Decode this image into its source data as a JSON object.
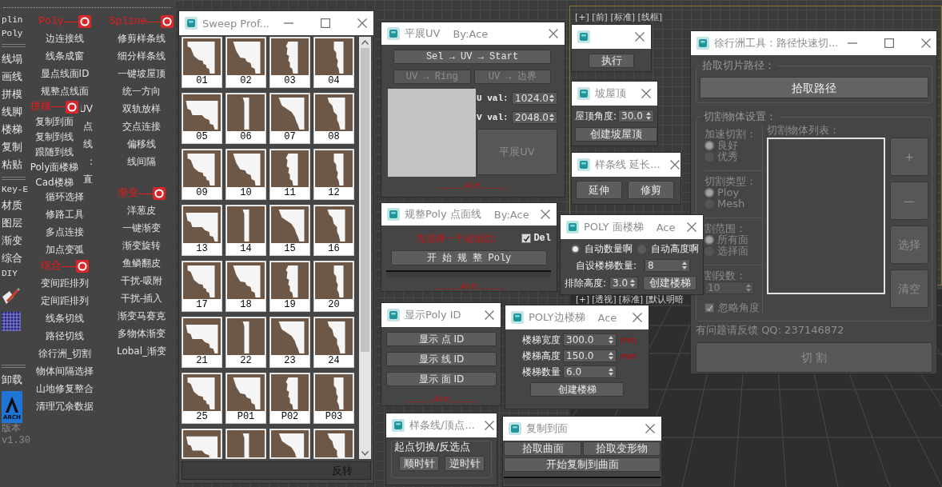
{
  "toolbar": {
    "side": [
      {
        "kind": "latin",
        "label": "plin"
      },
      {
        "kind": "latin",
        "label": "Poly"
      },
      {
        "kind": "divider"
      },
      {
        "kind": "text",
        "label": "线塌"
      },
      {
        "kind": "text",
        "label": "画线"
      },
      {
        "kind": "text",
        "label": "拼模"
      },
      {
        "kind": "text",
        "label": "线脚"
      },
      {
        "kind": "text",
        "label": "楼梯"
      },
      {
        "kind": "text",
        "label": "复制"
      },
      {
        "kind": "text",
        "label": "粘贴"
      },
      {
        "kind": "divider"
      },
      {
        "kind": "latin",
        "label": "Key-E"
      },
      {
        "kind": "text",
        "label": "材质"
      },
      {
        "kind": "text",
        "label": "图层"
      },
      {
        "kind": "text",
        "label": "渐变"
      },
      {
        "kind": "text",
        "label": "综合"
      },
      {
        "kind": "latin",
        "label": "DIY"
      },
      {
        "kind": "brush_icon"
      },
      {
        "kind": "grid_icon"
      },
      {
        "kind": "divider"
      },
      {
        "kind": "text",
        "label": "卸载"
      },
      {
        "kind": "logo",
        "label": "ARCH"
      },
      {
        "kind": "version",
        "label": "版本"
      },
      {
        "kind": "version",
        "label": "v1.30"
      }
    ],
    "columns": [
      {
        "sections": [
          {
            "header": "Poly",
            "items": [
              {
                "label": "边连接线",
                "covered": false
              },
              {
                "label": "线条成窗",
                "covered": false
              },
              {
                "label": "显点线面ID",
                "covered": false
              },
              {
                "label": "规整点线面",
                "covered": false
              },
              {
                "label": "UV",
                "covered": true
              },
              {
                "label": "点",
                "covered": true
              },
              {
                "label": "线",
                "covered": true
              },
              {
                "label": ":",
                "covered": true
              },
              {
                "label": "直",
                "covered": true
              },
              {
                "label": "循环选择",
                "covered": false
              },
              {
                "label": "修路工具",
                "covered": false
              },
              {
                "label": "多点连接",
                "covered": false
              },
              {
                "label": "加点变弧",
                "covered": false
              }
            ]
          },
          {
            "header": "综合",
            "items": [
              {
                "label": "变间距排列"
              },
              {
                "label": "定间距排列"
              },
              {
                "label": "线条切线"
              },
              {
                "label": "路径切线"
              },
              {
                "label": "徐行洲_切割"
              },
              {
                "label": "物体间隔选择"
              },
              {
                "label": "山地修复整合"
              },
              {
                "label": "清理冗余数据"
              }
            ]
          }
        ]
      },
      {
        "sections": [
          {
            "header": "Spline",
            "items": [
              {
                "label": "修剪样条线"
              },
              {
                "label": "细分样条线"
              },
              {
                "label": "一键坡屋顶"
              },
              {
                "label": "统一方向"
              },
              {
                "label": "双轨放样"
              },
              {
                "label": "交点连接"
              },
              {
                "label": "偏移线"
              },
              {
                "label": "线间隔"
              }
            ]
          },
          {
            "header": "渐变",
            "items": [
              {
                "label": "洋葱皮"
              },
              {
                "label": "一键渐变"
              },
              {
                "label": "渐变旋转"
              },
              {
                "label": "鱼鳞翻皮"
              },
              {
                "label": "干扰-吸附"
              },
              {
                "label": "干扰-插入"
              },
              {
                "label": "渐变马赛克"
              },
              {
                "label": "多物体渐变"
              },
              {
                "label": "Lobal_渐变"
              }
            ]
          }
        ]
      }
    ],
    "popup": {
      "header": "拼模",
      "items": [
        "复制到面",
        "复制到线",
        "跟随到线",
        "Poly面楼梯",
        "Cad楼梯"
      ]
    }
  },
  "viewport_labels": [
    "[+] [前] [标准] [线框]",
    "[+] [透视] [标准] [默认明暗"
  ],
  "windows": [
    {
      "kind": "profiles",
      "title": "Sweep Prof...",
      "min_max": true,
      "profiles": [
        {
          "label": "01",
          "cut_off": false
        },
        {
          "label": "02",
          "cut_off": false
        },
        {
          "label": "03",
          "cut_off": false
        },
        {
          "label": "04",
          "cut_off": false
        },
        {
          "label": "05",
          "cut_off": false
        },
        {
          "label": "06",
          "cut_off": false
        },
        {
          "label": "07",
          "cut_off": false
        },
        {
          "label": "08",
          "cut_off": false
        },
        {
          "label": "09",
          "cut_off": false
        },
        {
          "label": "10",
          "cut_off": false
        },
        {
          "label": "11",
          "cut_off": false
        },
        {
          "label": "12",
          "cut_off": false
        },
        {
          "label": "13",
          "cut_off": false
        },
        {
          "label": "14",
          "cut_off": false
        },
        {
          "label": "15",
          "cut_off": false
        },
        {
          "label": "16",
          "cut_off": false
        },
        {
          "label": "17",
          "cut_off": false
        },
        {
          "label": "18",
          "cut_off": false
        },
        {
          "label": "19",
          "cut_off": false
        },
        {
          "label": "20",
          "cut_off": false
        },
        {
          "label": "21",
          "cut_off": false
        },
        {
          "label": "22",
          "cut_off": false
        },
        {
          "label": "23",
          "cut_off": false
        },
        {
          "label": "24",
          "cut_off": false
        },
        {
          "label": "25",
          "cut_off": false
        },
        {
          "label": "P01",
          "cut_off": false
        },
        {
          "label": "P02",
          "cut_off": false
        },
        {
          "label": "P03",
          "cut_off": false
        },
        {
          "cut_off": true
        },
        {
          "cut_off": true
        },
        {
          "cut_off": true
        },
        {
          "cut_off": true
        }
      ],
      "footer_button": "反转"
    },
    {
      "kind": "flatten_uv",
      "title": "平展UV",
      "byline": "By:Ace",
      "buttons": [
        {
          "label": "Sel → UV → Start",
          "disabled": false
        },
        {
          "label": "UV → Ring",
          "disabled": true
        },
        {
          "label": "UV → 边界",
          "disabled": true
        }
      ],
      "fields": [
        {
          "label": "U val:",
          "value": "1024.0"
        },
        {
          "label": "V val:",
          "value": "2048.0"
        }
      ],
      "action": {
        "label": "平展UV",
        "disabled": true
      },
      "signature": "_____Ace_____"
    },
    {
      "kind": "tidy_poly",
      "title": "规整Poly 点面线",
      "byline": "By:Ace",
      "hint": "先选择一个起始边:",
      "checkbox": {
        "label": "Del",
        "checked": true
      },
      "button": "开 始 规 整 Poly",
      "progress": {
        "level": 0
      },
      "signature": "_____Ace_____"
    },
    {
      "kind": "show_ids",
      "title": "显示Poly ID",
      "buttons": [
        "显示 点 ID",
        "显示 线 ID",
        "显示 面 ID"
      ],
      "signature": "_____Ace_____"
    },
    {
      "kind": "spline_vertex",
      "title": "样条线/顶点...",
      "group": "起点切换/反选点",
      "buttons": [
        "顺时针",
        "逆时针"
      ]
    },
    {
      "kind": "edge_stairs",
      "title": "POLY边楼梯",
      "byline": "Ace",
      "fields": [
        {
          "label": "楼梯宽度",
          "value": "300.0",
          "unit": "mm"
        },
        {
          "label": "楼梯高度",
          "value": "150.0",
          "unit": "mm"
        },
        {
          "label": "楼梯数量",
          "value": "6.0"
        }
      ],
      "button": "创建楼梯"
    },
    {
      "kind": "copy_to_surface",
      "title": "复制到面",
      "buttons": [
        "拾取曲面",
        "拾取变形物",
        "开始复制到曲面"
      ],
      "progress": {
        "level": 0
      }
    },
    {
      "kind": "execute",
      "button": "执行"
    },
    {
      "kind": "roof",
      "title": "坡屋顶",
      "fields": [
        {
          "label": "屋顶角度:",
          "value": "30.0"
        }
      ],
      "button": "创建坡屋顶"
    },
    {
      "kind": "spline_extend",
      "title": "样条线 延长...",
      "buttons": [
        "延伸",
        "修剪"
      ]
    },
    {
      "kind": "path_cut",
      "title": "徐行洲工具：路径快速切...",
      "min_max": true,
      "path_group": "拾取切片路径：",
      "path_button": "拾取路径",
      "settings_group": "切割物体设置：",
      "options": [
        {
          "label": "加速切割：",
          "choices": [
            {
              "label": "良好",
              "selected": true
            },
            {
              "label": "优秀",
              "selected": false
            }
          ]
        },
        {
          "label": "切割类型：",
          "choices": [
            {
              "label": "Ploy",
              "selected": true
            },
            {
              "label": "Mesh",
              "selected": false
            }
          ]
        },
        {
          "label": "割范围：",
          "choices": [
            {
              "label": "所有面",
              "selected": true
            },
            {
              "label": "选择面",
              "selected": false
            }
          ]
        }
      ],
      "segments": {
        "label": "割段数：",
        "value": "10",
        "disabled": true
      },
      "checkbox": {
        "label": "忽略角度",
        "checked": true
      },
      "list_label": "切割物体列表：",
      "list_buttons": [
        {
          "label": "+",
          "disabled": true
        },
        {
          "label": "—",
          "disabled": true
        },
        {
          "label": "选择",
          "disabled": true
        },
        {
          "label": "清空",
          "disabled": true
        }
      ],
      "feedback": "有问题请反馈 QQ: 237146872",
      "cut_button": {
        "label": "切  割",
        "disabled": true
      }
    },
    {
      "kind": "face_stairs",
      "title": "POLY 面楼梯",
      "byline": "Ace",
      "radios": [
        {
          "label": "自动数量啊",
          "selected": true
        },
        {
          "label": "自动高度啊",
          "selected": false
        }
      ],
      "fields": [
        {
          "label": "自设楼梯数量:",
          "value": "8"
        },
        {
          "label": "排除高度:",
          "value": "3.0"
        }
      ],
      "button": "创建楼梯"
    }
  ]
}
